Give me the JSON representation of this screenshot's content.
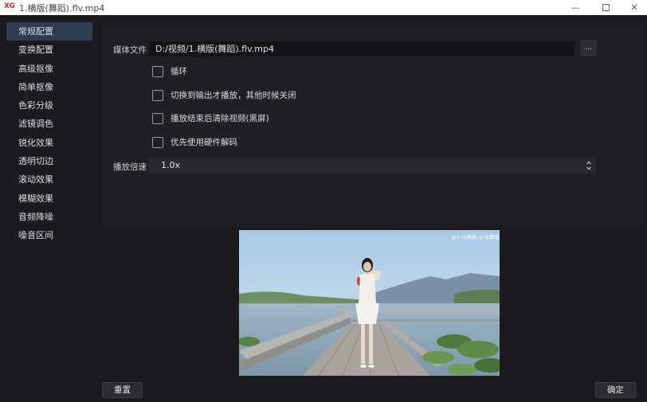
{
  "window": {
    "logo": "XG",
    "title": "1.横版(舞蹈).flv.mp4",
    "minimize": "—",
    "close": "✕"
  },
  "sidebar": {
    "items": [
      {
        "label": "常规配置",
        "active": true
      },
      {
        "label": "变换配置"
      },
      {
        "label": "高级抠像"
      },
      {
        "label": "简单抠像"
      },
      {
        "label": "色彩分级"
      },
      {
        "label": "滤镜调色"
      },
      {
        "label": "锐化效果"
      },
      {
        "label": "透明切边"
      },
      {
        "label": "滚动效果"
      },
      {
        "label": "模糊效果"
      },
      {
        "label": "音频降噪"
      },
      {
        "label": "噪音区间"
      }
    ]
  },
  "config": {
    "media_file_label": "媒体文件",
    "media_file_value": "D:/视频/1.横版(舞蹈).flv.mp4",
    "browse_label": "...",
    "options": [
      {
        "label": "循环",
        "checked": false
      },
      {
        "label": "切换到输出才播放，其他时候关闭",
        "checked": false
      },
      {
        "label": "播放结束后清除视频(黑屏)",
        "checked": false
      },
      {
        "label": "优先使用硬件解码",
        "checked": false
      }
    ],
    "speed_label": "播放倍速",
    "speed_value": "1.0x"
  },
  "preview": {
    "watermark": "@小马舞蹈 小马舞蹈"
  },
  "buttons": {
    "reset": "重置",
    "ok": "确定"
  }
}
